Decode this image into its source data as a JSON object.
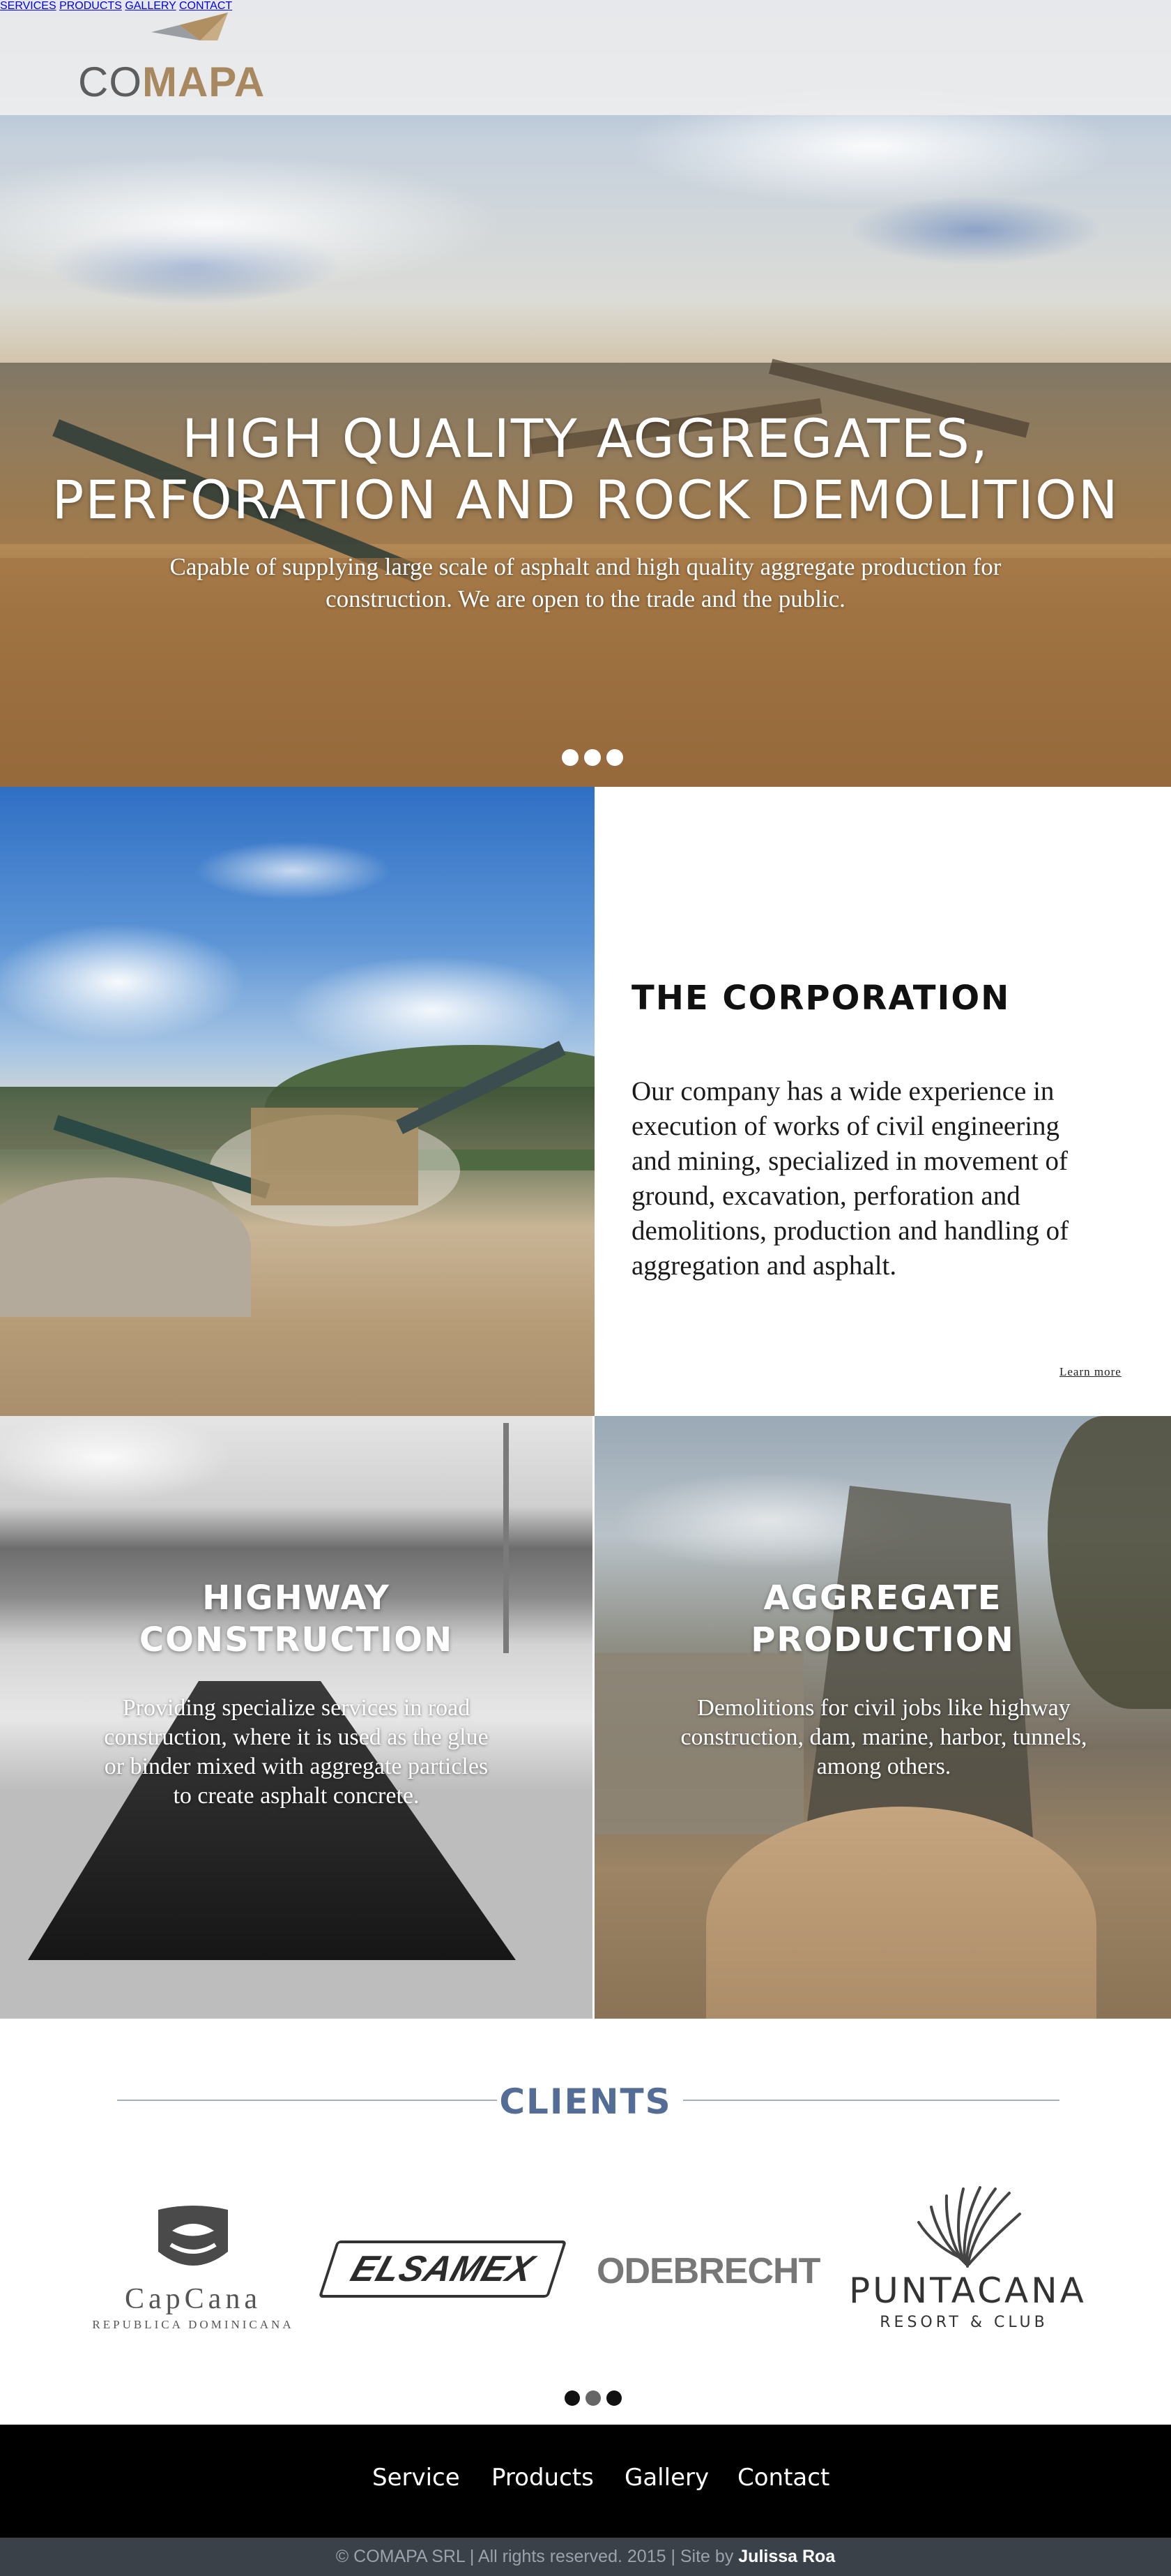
{
  "header": {
    "logo": {
      "text_co": "CO",
      "text_mapa": "MAPA"
    },
    "nav": [
      {
        "label": "SERVICES"
      },
      {
        "label": "PRODUCTS"
      },
      {
        "label": "GALLERY"
      },
      {
        "label": "CONTACT"
      }
    ]
  },
  "hero": {
    "title_line1": "HIGH QUALITY AGGREGATES,",
    "title_line2": "PERFORATION AND ROCK DEMOLITION",
    "subtitle": "Capable of supplying large scale of asphalt and high quality aggregate production for construction. We are open to the trade and the public.",
    "slides_count": 3
  },
  "corporation": {
    "title": "THE CORPORATION",
    "body": "Our company has a wide experience in execution of works of civil engineering and mining, specialized in movement of ground, excavation, perforation and demolitions, production and handling of aggregation and asphalt.",
    "link": "Learn more"
  },
  "services": [
    {
      "title_line1": "HIGHWAY",
      "title_line2": "CONSTRUCTION",
      "text": "Providing specialize services in road construction, where it is used as the glue or binder mixed with aggregate particles to create asphalt concrete."
    },
    {
      "title_line1": "AGGREGATE",
      "title_line2": "PRODUCTION",
      "text": "Demolitions for civil jobs like highway construction, dam, marine, harbor, tunnels, among others."
    }
  ],
  "clients": {
    "title": "CLIENTS",
    "logos": {
      "capcana": {
        "name": "CapCana",
        "sub": "REPUBLICA DOMINICANA"
      },
      "elsamex": {
        "name": "ELSAMEX"
      },
      "odebrecht": {
        "name": "ODEBRECHT"
      },
      "puntacana": {
        "name": "PUNTACANA",
        "sub": "RESORT & CLUB"
      }
    }
  },
  "footer": {
    "nav": [
      {
        "label": "Service"
      },
      {
        "label": "Products"
      },
      {
        "label": "Gallery"
      },
      {
        "label": "Contact"
      }
    ],
    "copyright": "© COMAPA SRL  |  All rights reserved. 2015   |  Site by ",
    "author": "Julissa Roa"
  },
  "colors": {
    "brand_gold": "#a8895f",
    "nav_text": "#7e6848",
    "clients_title": "#536d96",
    "footer_bg": "#000000",
    "footer_bottom_bg": "#3a4149"
  }
}
